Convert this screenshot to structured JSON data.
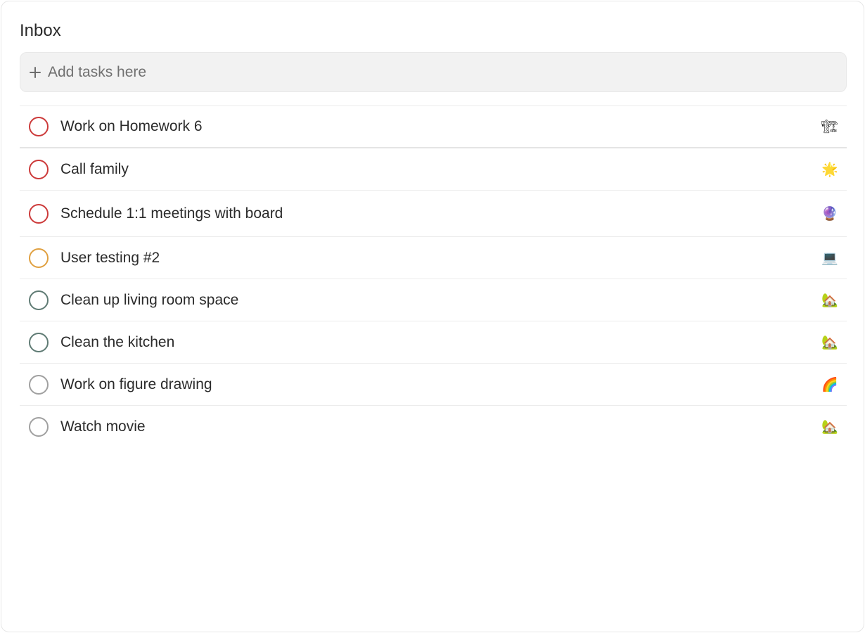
{
  "inbox": {
    "title": "Inbox",
    "add_placeholder": "Add tasks here"
  },
  "colors": {
    "priority_high": "#cc3a3a",
    "priority_medium": "#e0a040",
    "priority_low": "#5f7b74",
    "priority_none": "#a0a0a0"
  },
  "tasks": [
    {
      "label": "Work on Homework 6",
      "emoji": "🏗",
      "priority_color": "#cc3a3a"
    },
    {
      "label": "Call family",
      "emoji": "🌟",
      "priority_color": "#cc3a3a"
    },
    {
      "label": "Schedule 1:1 meetings with board",
      "emoji": "🔮",
      "priority_color": "#cc3a3a"
    },
    {
      "label": "User testing #2",
      "emoji": "💻",
      "priority_color": "#e0a040"
    },
    {
      "label": "Clean up living room space",
      "emoji": "🏡",
      "priority_color": "#5f7b74"
    },
    {
      "label": "Clean the kitchen",
      "emoji": "🏡",
      "priority_color": "#5f7b74"
    },
    {
      "label": "Work on figure drawing",
      "emoji": "🌈",
      "priority_color": "#a0a0a0"
    },
    {
      "label": "Watch movie",
      "emoji": "🏡",
      "priority_color": "#a0a0a0"
    }
  ]
}
